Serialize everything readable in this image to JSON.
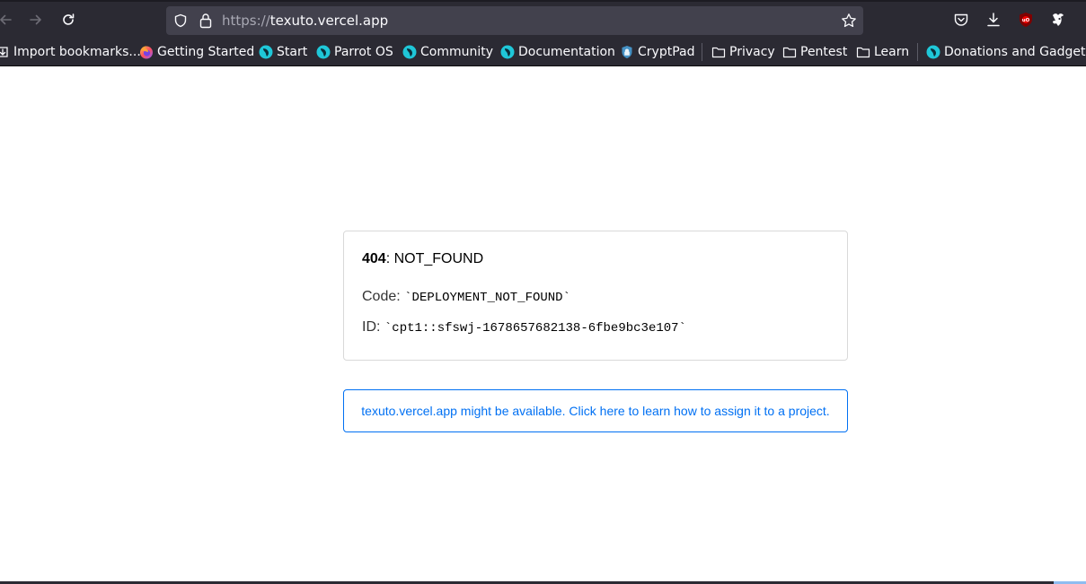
{
  "browser": {
    "url_scheme": "https://",
    "url_host": "texuto.vercel.app"
  },
  "bookmarks": [
    {
      "label": "Import bookmarks...",
      "icon": "import-icon"
    },
    {
      "label": "Getting Started",
      "icon": "firefox-icon"
    },
    {
      "label": "Start",
      "icon": "parrot-icon"
    },
    {
      "label": "Parrot OS",
      "icon": "parrot-icon"
    },
    {
      "label": "Community",
      "icon": "parrot-icon"
    },
    {
      "label": "Documentation",
      "icon": "parrot-icon"
    },
    {
      "label": "CryptPad",
      "icon": "cryptpad-icon"
    },
    {
      "label": "Privacy",
      "icon": "folder-icon"
    },
    {
      "label": "Pentest",
      "icon": "folder-icon"
    },
    {
      "label": "Learn",
      "icon": "folder-icon"
    },
    {
      "label": "Donations and Gadgets",
      "icon": "parrot-icon"
    }
  ],
  "error": {
    "status_code": "404",
    "status_text": ": NOT_FOUND",
    "code_label": "Code: ",
    "code_value": "`DEPLOYMENT_NOT_FOUND`",
    "id_label": "ID: ",
    "id_value": "`cpt1::sfswj-1678657682138-6fbe9bc3e107`"
  },
  "cta_text": "texuto.vercel.app might be available. Click here to learn how to assign it to a project.",
  "colors": {
    "chrome_bg": "#2b2a33",
    "urlbar_bg": "#42414d",
    "link_blue": "#0070f3",
    "parrot_cyan": "#1fc7d8"
  }
}
